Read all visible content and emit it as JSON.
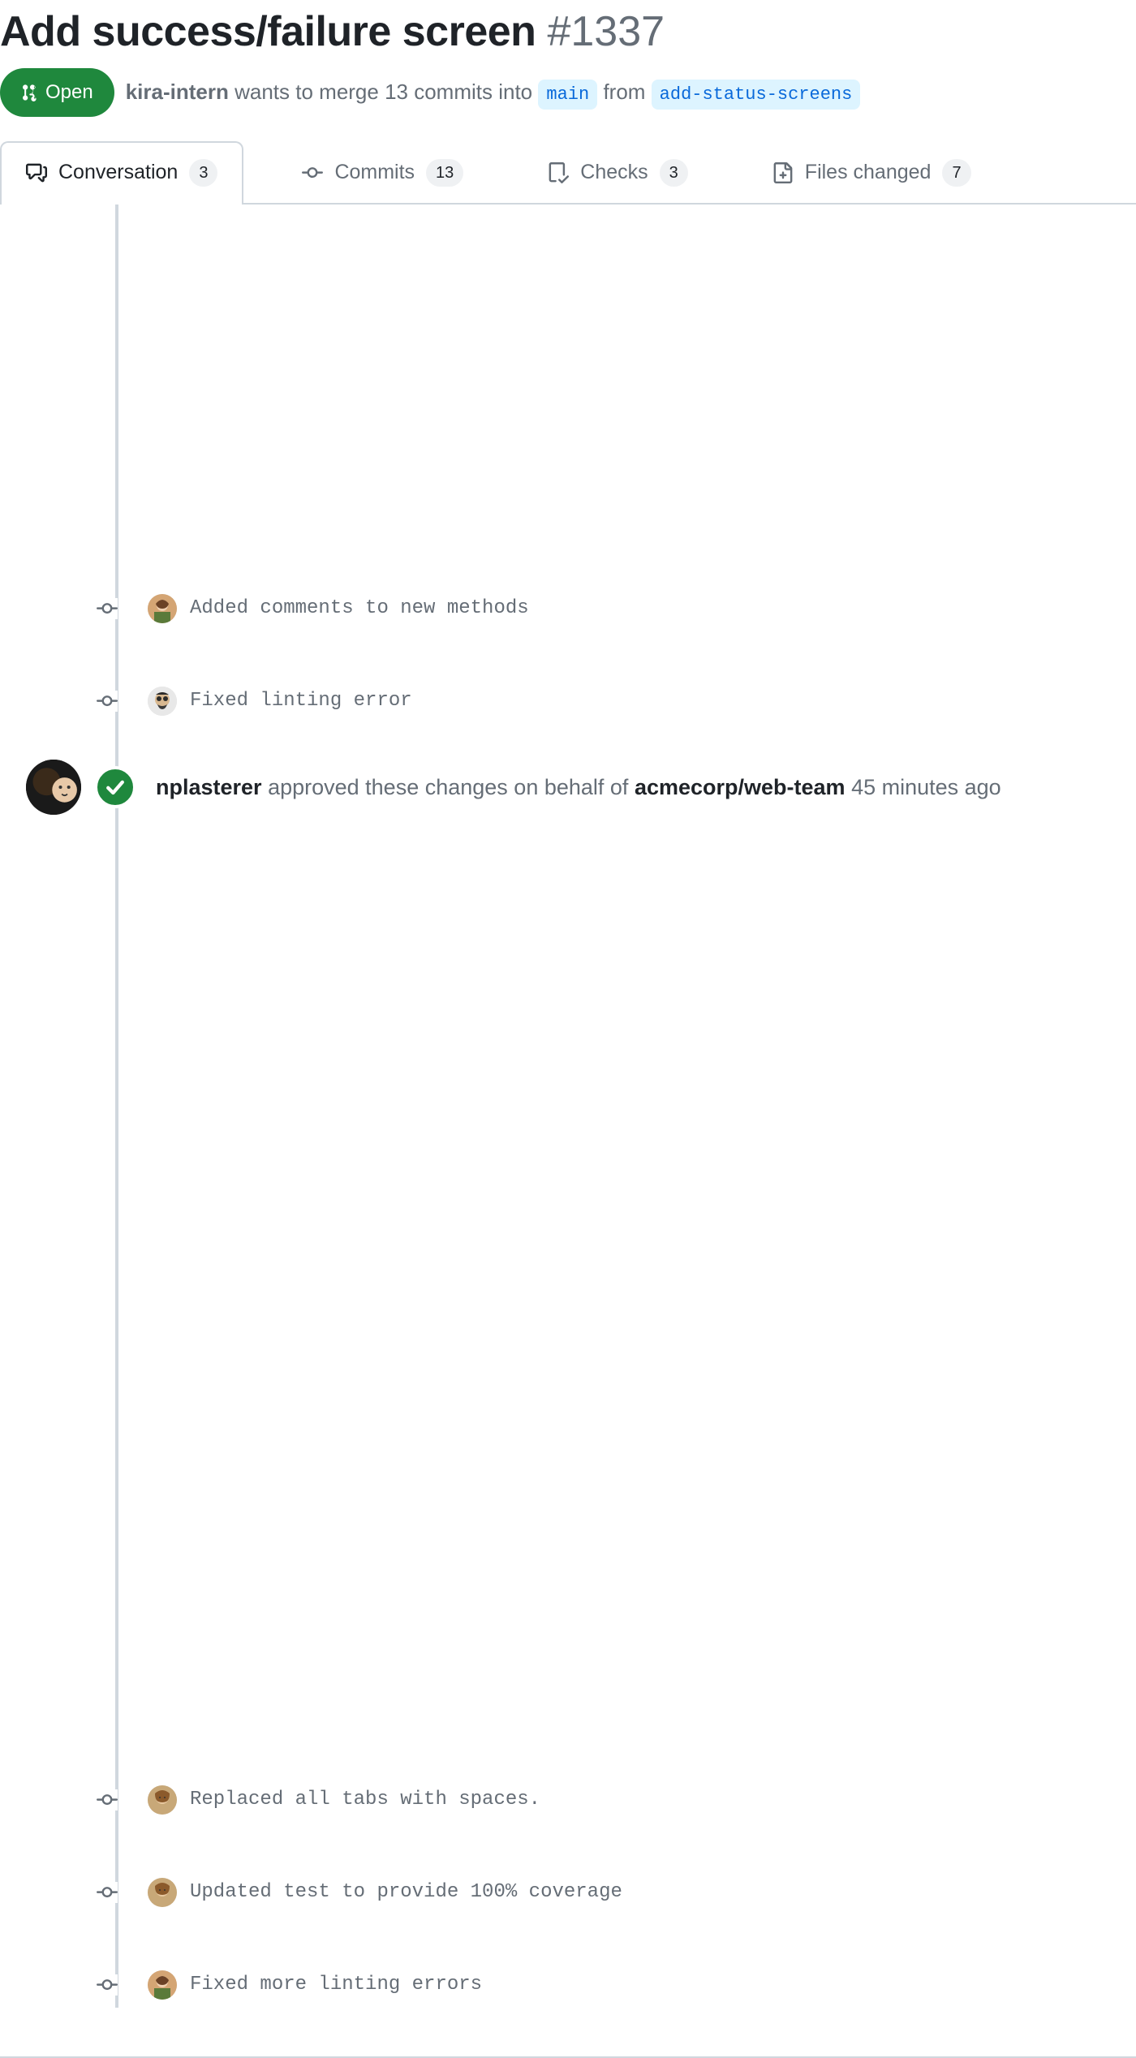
{
  "pr": {
    "title": "Add success/failure screen",
    "number": "#1337",
    "state_label": "Open"
  },
  "meta": {
    "author": "kira-intern",
    "text_1": "wants to merge 13 commits into",
    "base_branch": "main",
    "text_2": "from",
    "compare_branch": "add-status-screens"
  },
  "tabs": {
    "conversation": {
      "label": "Conversation",
      "count": "3"
    },
    "commits": {
      "label": "Commits",
      "count": "13"
    },
    "checks": {
      "label": "Checks",
      "count": "3"
    },
    "files": {
      "label": "Files changed",
      "count": "7"
    }
  },
  "commits_top": [
    {
      "message": "Added comments to new methods",
      "avatar": "a"
    },
    {
      "message": "Fixed linting error",
      "avatar": "b"
    }
  ],
  "review": {
    "user": "nplasterer",
    "text_1": "approved these changes on behalf of",
    "team": "acmecorp/web-team",
    "time": "45 minutes ago"
  },
  "commits_bottom": [
    {
      "message": "Replaced all tabs with spaces.",
      "avatar": "c"
    },
    {
      "message": "Updated test to provide 100% coverage",
      "avatar": "c"
    },
    {
      "message": "Fixed more linting errors",
      "avatar": "a"
    }
  ]
}
